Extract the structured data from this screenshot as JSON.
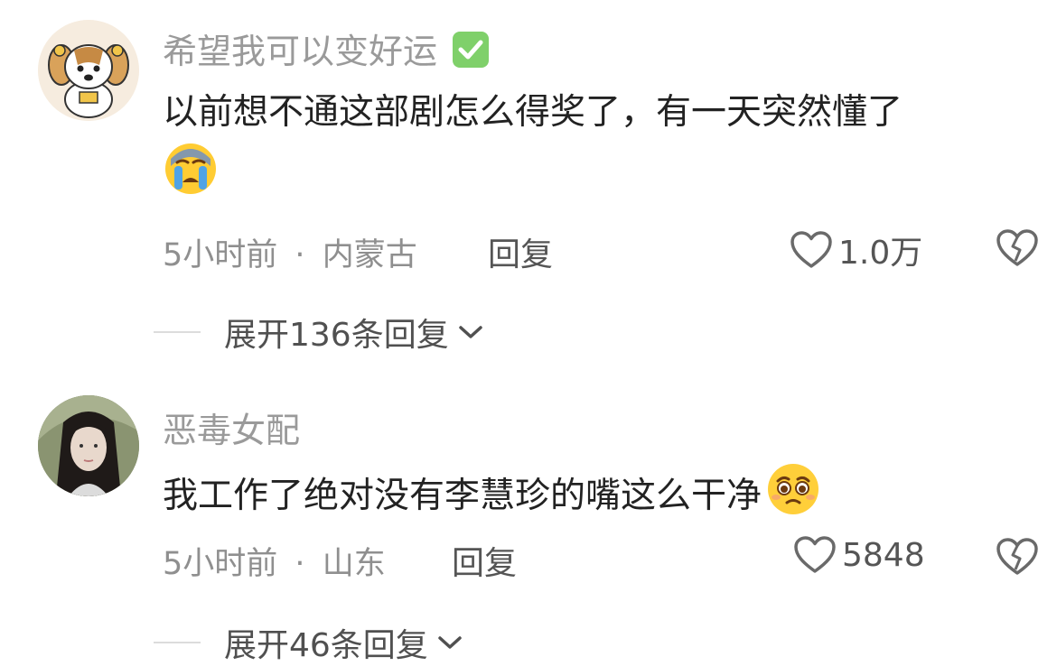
{
  "comments": [
    {
      "username": "希望我可以变好运",
      "verified": true,
      "text": "以前想不通这部剧怎么得奖了，有一天突然懂了",
      "emoji": "crying-emoji",
      "time": "5小时前",
      "separator": "·",
      "location": "内蒙古",
      "reply_label": "回复",
      "likes": "1.0万",
      "expand_label": "展开136条回复"
    },
    {
      "username": "恶毒女配",
      "verified": false,
      "text": "我工作了绝对没有李慧珍的嘴这么干净",
      "emoji": "pleading-emoji",
      "time": "5小时前",
      "separator": "·",
      "location": "山东",
      "reply_label": "回复",
      "likes": "5848",
      "expand_label": "展开46条回复"
    }
  ],
  "colors": {
    "username": "#9a9a9a",
    "text": "#222222",
    "meta": "#8f8f8f",
    "verified_green": "#7fd06a"
  }
}
